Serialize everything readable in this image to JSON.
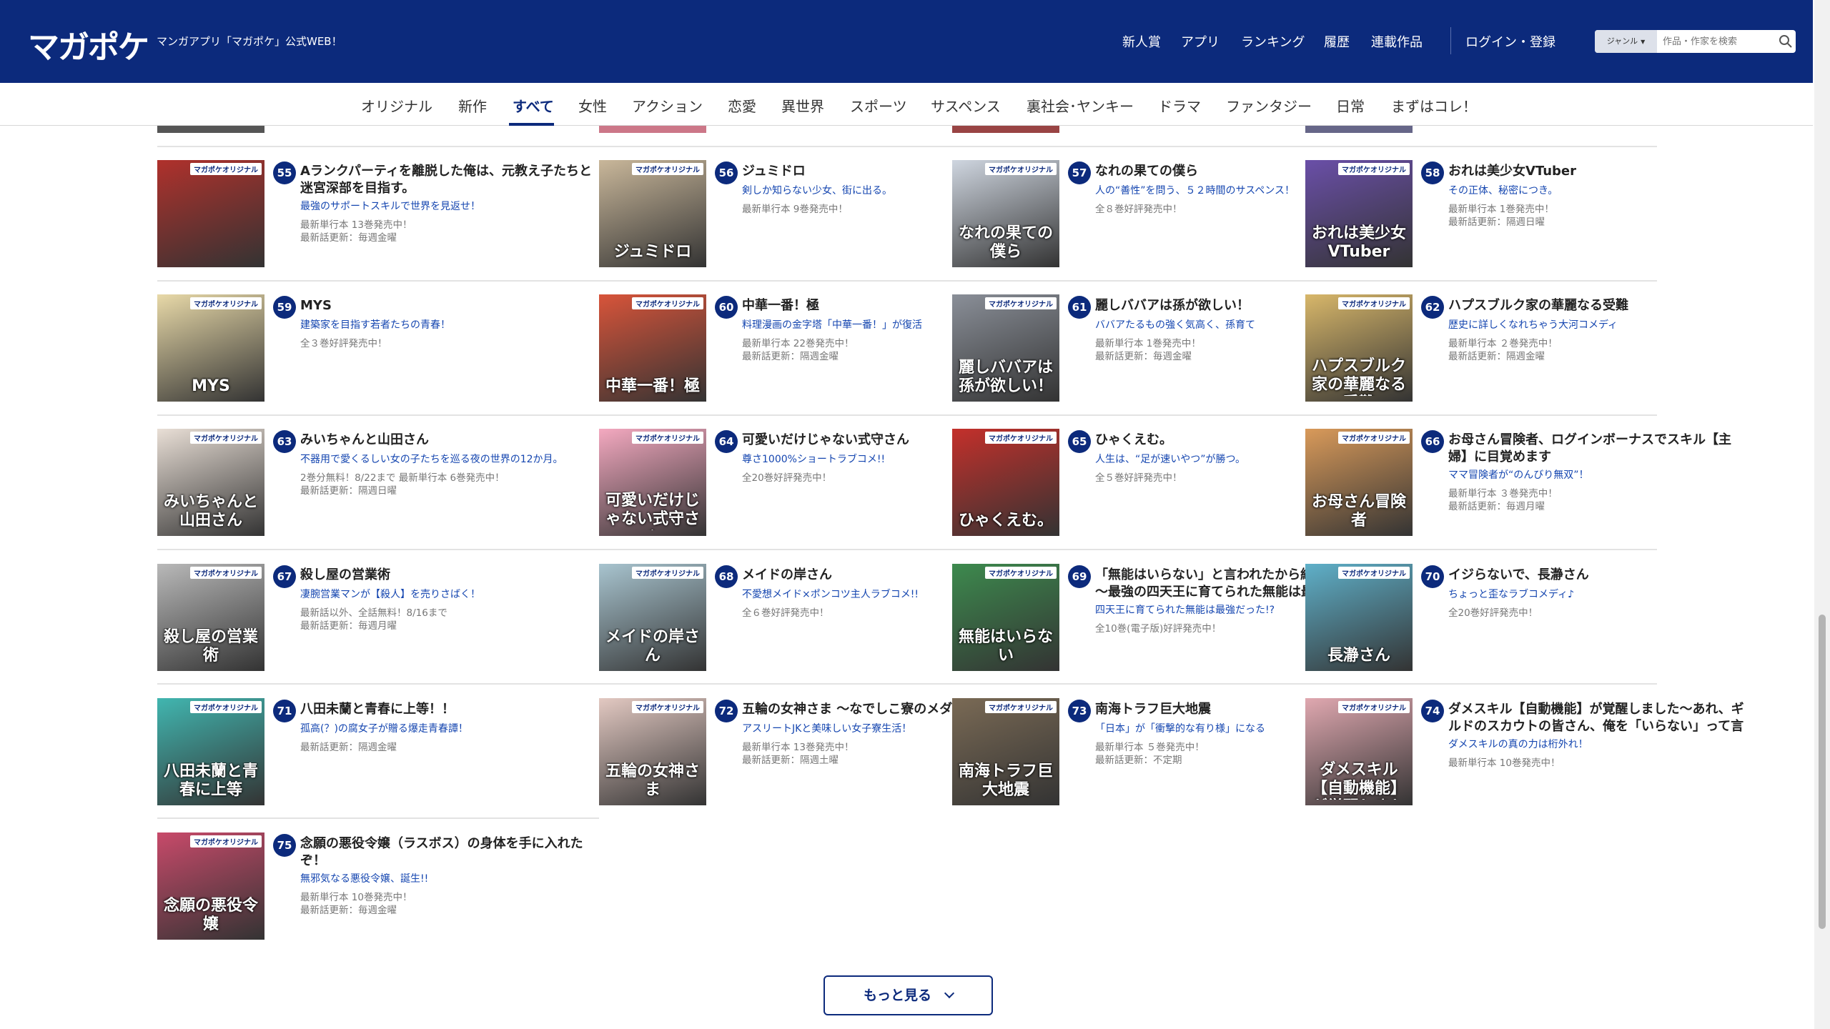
{
  "header": {
    "logo": "マガポケ",
    "tagline": "マンガアプリ「マガポケ」公式WEB！",
    "nav": [
      "新人賞",
      "アプリ",
      "ランキング",
      "履歴",
      "連載作品"
    ],
    "login": "ログイン・登録",
    "search": {
      "genre": "ジャンル",
      "placeholder": "作品・作家を検索"
    }
  },
  "categories": {
    "items": [
      "オリジナル",
      "新作",
      "すべて",
      "女性",
      "アクション",
      "恋愛",
      "異世界",
      "スポーツ",
      "サスペンス",
      "裏社会･ヤンキー",
      "ドラマ",
      "ファンタジー",
      "日常",
      "まずはコレ！"
    ],
    "active": "すべて"
  },
  "cover_label": "マガポケオリジナル",
  "items": [
    {
      "rank": "55",
      "title": "Aランクパーティを離脱した俺は、元教え子たちと迷宮深部を目指す。",
      "catch": "最強のサポートスキルで世界を見返せ！",
      "info": [
        "最新単行本 13巻発売中！",
        "最新話更新：毎週金曜"
      ],
      "cover_text": "",
      "color": "#b0312c"
    },
    {
      "rank": "56",
      "title": "ジュミドロ",
      "catch": "剣しか知らない少女、街に出る。",
      "info": [
        "最新単行本 9巻発売中！"
      ],
      "cover_text": "ジュミドロ",
      "color": "#c9b79a"
    },
    {
      "rank": "57",
      "title": "なれの果ての僕ら",
      "catch": "人の“善性”を問う、５２時間のサスペンス！",
      "info": [
        "全８巻好評発売中！"
      ],
      "cover_text": "なれの果ての僕ら",
      "color": "#cfd6e0"
    },
    {
      "rank": "58",
      "title": "おれは美少女VTuber",
      "catch": "その正体、秘密につき。",
      "info": [
        "最新単行本 1巻発売中！",
        "最新話更新：隔週日曜"
      ],
      "cover_text": "おれは美少女VTuber",
      "color": "#6a4fa8"
    },
    {
      "rank": "59",
      "title": "MYS",
      "catch": "建築家を目指す若者たちの青春！",
      "info": [
        "全３巻好評発売中！"
      ],
      "cover_text": "MYS",
      "color": "#e8d9a8"
    },
    {
      "rank": "60",
      "title": "中華一番！極",
      "catch": "料理漫画の金字塔「中華一番！」が復活",
      "info": [
        "最新単行本 22巻発売中！",
        "最新話更新：隔週金曜"
      ],
      "cover_text": "中華一番！極",
      "color": "#d8543a"
    },
    {
      "rank": "61",
      "title": "麗しババアは孫が欲しい！",
      "catch": "ババアたるもの強く気高く、孫育て",
      "info": [
        "最新単行本 1巻発売中！",
        "最新話更新：毎週金曜"
      ],
      "cover_text": "麗しババアは孫が欲しい！",
      "color": "#8a8f98"
    },
    {
      "rank": "62",
      "title": "ハプスブルク家の華麗なる受難",
      "catch": "歴史に詳しくなれちゃう大河コメディ",
      "info": [
        "最新単行本 ２巻発売中！",
        "最新話更新：隔週金曜"
      ],
      "cover_text": "ハプスブルク家の華麗なる受難",
      "color": "#d8b76a"
    },
    {
      "rank": "63",
      "title": "みいちゃんと山田さん",
      "catch": "不器用で愛くるしい女の子たちを巡る夜の世界の12か月。",
      "info": [
        "2巻分無料！8/22まで 最新単行本 6巻発売中！",
        "最新話更新：隔週日曜"
      ],
      "cover_text": "みいちゃんと山田さん",
      "color": "#e9dfd6"
    },
    {
      "rank": "64",
      "title": "可愛いだけじゃない式守さん",
      "catch": "尊さ1000%ショートラブコメ!!",
      "info": [
        "全20巻好評発売中！"
      ],
      "cover_text": "可愛いだけじゃない式守さん",
      "color": "#f4a9c0"
    },
    {
      "rank": "65",
      "title": "ひゃくえむ。",
      "catch": "人生は、“足が速いやつ”が勝つ。",
      "info": [
        "全５巻好評発売中！"
      ],
      "cover_text": "ひゃくえむ。",
      "color": "#c4302b"
    },
    {
      "rank": "66",
      "title": "お母さん冒険者、ログインボーナスでスキル【主婦】に目覚めます",
      "catch": "ママ冒険者が“のんびり無双”！",
      "info": [
        "最新単行本 ３巻発売中！",
        "最新話更新：毎週月曜"
      ],
      "cover_text": "お母さん冒険者",
      "color": "#d99a5a"
    },
    {
      "rank": "67",
      "title": "殺し屋の営業術",
      "catch": "凄腕営業マンが【殺人】を売りさばく！",
      "info": [
        "最新話以外、全話無料！8/16まで",
        "最新話更新：毎週月曜"
      ],
      "cover_text": "殺し屋の営業術",
      "color": "#b9b9b9"
    },
    {
      "rank": "68",
      "title": "メイドの岸さん",
      "catch": "不愛想メイド×ポンコツ主人ラブコメ!!",
      "info": [
        "全６巻好評発売中！"
      ],
      "cover_text": "メイドの岸さん",
      "color": "#a8c4cf"
    },
    {
      "rank": "69",
      "title": "「無能はいらない」と言われたから絶縁してやった　～最強の四天王に育てられた無能は最強だった!?",
      "catch": "四天王に育てられた無能は最強だった!?",
      "info": [
        "全10巻(電子版)好評発売中！"
      ],
      "cover_text": "無能はいらない",
      "color": "#3d8a4e"
    },
    {
      "rank": "70",
      "title": "イジらないで、長瀞さん",
      "catch": "ちょっと歪なラブコメディ♪",
      "info": [
        "全20巻好評発売中！"
      ],
      "cover_text": "長瀞さん",
      "color": "#5fb0c9"
    },
    {
      "rank": "71",
      "title": "八田未蘭と青春に上等！！",
      "catch": "孤高(？)の腐女子が贈る爆走青春譚！",
      "info": [
        "最新話更新：隔週金曜"
      ],
      "cover_text": "八田未蘭と青春に上等",
      "color": "#41b6b0"
    },
    {
      "rank": "72",
      "title": "五輪の女神さま 〜なでしこ寮のメダルごはん〜",
      "catch": "アスリートJKと美味しい女子寮生活！",
      "info": [
        "最新単行本 13巻発売中！",
        "最新話更新：隔週土曜"
      ],
      "cover_text": "五輪の女神さま",
      "color": "#e3c9c2"
    },
    {
      "rank": "73",
      "title": "南海トラフ巨大地震",
      "catch": "「日本」が「衝撃的な有り様」になる",
      "info": [
        "最新単行本 ５巻発売中！",
        "最新話更新：不定期"
      ],
      "cover_text": "南海トラフ巨大地震",
      "color": "#7a6a55"
    },
    {
      "rank": "74",
      "title": "ダメスキル【自動機能】が覚醒しました〜あれ、ギルドのスカウトの皆さん、俺を「いらない」って言いませんでした？〜",
      "catch": "ダメスキルの真の力は桁外れ！",
      "info": [
        "最新単行本 10巻発売中！"
      ],
      "cover_text": "ダメスキル【自動機能】が覚醒しました",
      "color": "#e0a8b0"
    },
    {
      "rank": "75",
      "title": "念願の悪役令嬢（ラスボス）の身体を手に入れたぞ！",
      "catch": "無邪気なる悪役令嬢、誕生!!",
      "info": [
        "最新単行本 10巻発売中！",
        "最新話更新：毎週金曜"
      ],
      "cover_text": "念願の悪役令嬢",
      "color": "#c84a6a"
    }
  ],
  "more_button": "もっと見る"
}
